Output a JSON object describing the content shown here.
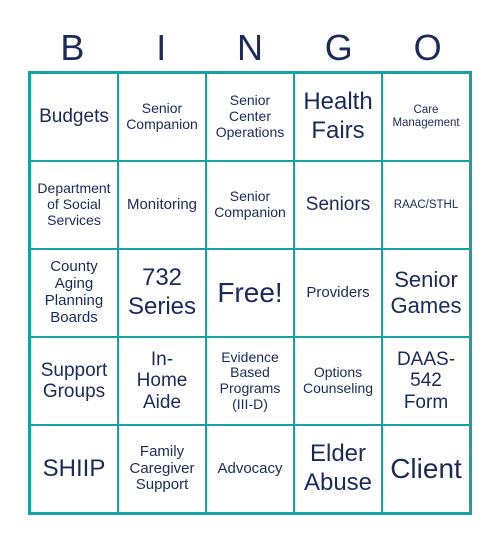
{
  "header": {
    "letters": [
      "B",
      "I",
      "N",
      "G",
      "O"
    ]
  },
  "board": {
    "rows": [
      [
        "Budgets",
        "Senior\nCompanion",
        "Senior\nCenter\nOperations",
        "Health\nFairs",
        "Care\nManagement"
      ],
      [
        "Department\nof Social\nServices",
        "Monitoring",
        "Senior\nCompanion",
        "Seniors",
        "RAAC/STHL"
      ],
      [
        "County\nAging\nPlanning\nBoards",
        "732\nSeries",
        "Free!",
        "Providers",
        "Senior\nGames"
      ],
      [
        "Support\nGroups",
        "In-\nHome\nAide",
        "Evidence\nBased\nPrograms\n(III-D)",
        "Options\nCounseling",
        "DAAS-\n542\nForm"
      ],
      [
        "SHIIP",
        "Family\nCaregiver\nSupport",
        "Advocacy",
        "Elder\nAbuse",
        "Client"
      ]
    ]
  },
  "colors": {
    "grid": "#17a2a6",
    "text": "#1b2a5c"
  }
}
